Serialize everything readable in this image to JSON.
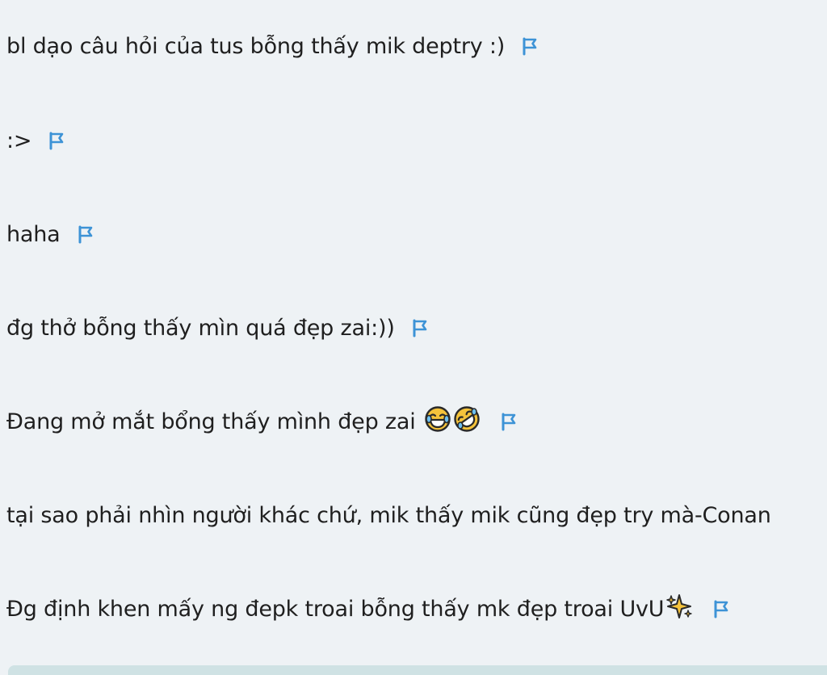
{
  "comments": [
    {
      "text": "bl dạo câu hỏi của tus bỗng thấy mik deptry :)",
      "flag_icon": "flag-icon"
    },
    {
      "text": ":>",
      "flag_icon": "flag-icon"
    },
    {
      "text": "haha",
      "flag_icon": "flag-icon"
    },
    {
      "text": "đg thở bỗng thấy mìn quá đẹp zai:))",
      "flag_icon": "flag-icon"
    },
    {
      "text": "Đang mở mắt bổng thấy mình đẹp zai",
      "emojis": [
        "tears-of-joy-emoji-icon",
        "rolling-laughing-emoji-icon"
      ],
      "flag_icon": "flag-icon"
    },
    {
      "text": "tại sao phải nhìn người khác chứ, mik thấy mik cũng đẹp try mà-Conan"
    },
    {
      "text": "Đg định khen mấy ng đepk troai bỗng thấy mk đẹp troai UvU",
      "emojis": [
        "sparkles-emoji-icon"
      ],
      "flag_icon": "flag-icon"
    }
  ],
  "colors": {
    "background": "#eef2f5",
    "text": "#1f1f1f",
    "flag_blue": "#3d93d6",
    "emoji_yellow": "#f5c33b",
    "bottom_bar": "#cfe2e4"
  }
}
